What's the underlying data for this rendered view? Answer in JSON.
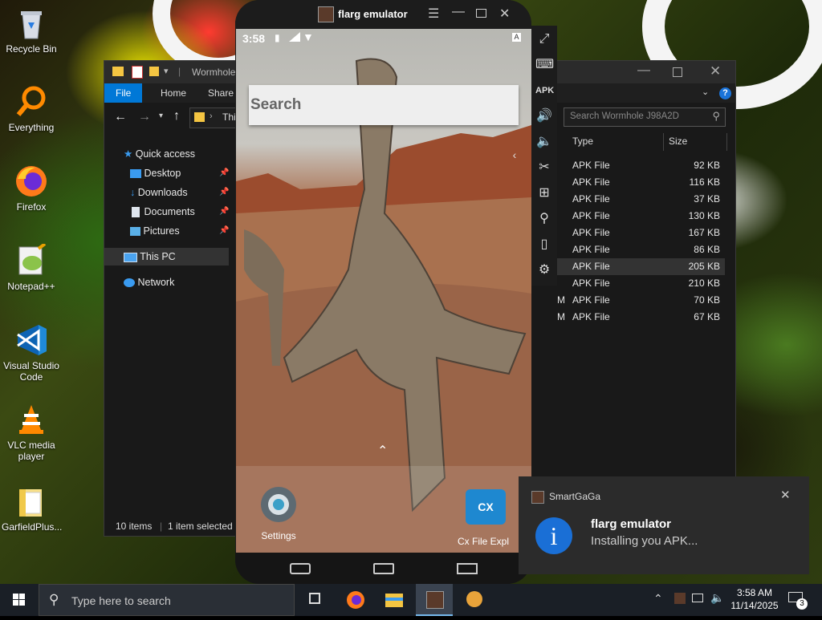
{
  "desktop": {
    "icons": [
      {
        "label": "Recycle Bin",
        "icon": "recycle-bin-icon"
      },
      {
        "label": "Everything",
        "icon": "everything-search-icon"
      },
      {
        "label": "Firefox",
        "icon": "firefox-icon"
      },
      {
        "label": "Notepad++",
        "icon": "notepad-plus-plus-icon"
      },
      {
        "label": "Visual Studio Code",
        "icon": "vscode-icon"
      },
      {
        "label": "VLC media player",
        "icon": "vlc-icon"
      },
      {
        "label": "GarfieldPlus...",
        "icon": "folder-icon"
      }
    ]
  },
  "explorer": {
    "title": "Wormhole",
    "ribbon_tabs": [
      "File",
      "Home",
      "Share"
    ],
    "address": "This",
    "search_placeholder": "Search Wormhole J98A2D",
    "nav": [
      {
        "label": "Quick access",
        "icon": "star-icon"
      },
      {
        "label": "Desktop",
        "icon": "desktop-folder-icon"
      },
      {
        "label": "Downloads",
        "icon": "downloads-icon"
      },
      {
        "label": "Documents",
        "icon": "documents-icon"
      },
      {
        "label": "Pictures",
        "icon": "pictures-icon"
      },
      {
        "label": "This PC",
        "icon": "pc-icon"
      },
      {
        "label": "Network",
        "icon": "network-icon"
      }
    ],
    "columns": {
      "type": "Type",
      "size": "Size"
    },
    "rows": [
      {
        "type": "APK File",
        "size": "92 KB",
        "clip": ""
      },
      {
        "type": "APK File",
        "size": "116 KB",
        "clip": ""
      },
      {
        "type": "APK File",
        "size": "37 KB",
        "clip": ""
      },
      {
        "type": "APK File",
        "size": "130 KB",
        "clip": ""
      },
      {
        "type": "APK File",
        "size": "167 KB",
        "clip": ""
      },
      {
        "type": "APK File",
        "size": "86 KB",
        "clip": ""
      },
      {
        "type": "APK File",
        "size": "205 KB",
        "clip": "",
        "selected": true
      },
      {
        "type": "APK File",
        "size": "210 KB",
        "clip": ""
      },
      {
        "type": "APK File",
        "size": "70 KB",
        "clip": "M"
      },
      {
        "type": "APK File",
        "size": "67 KB",
        "clip": "M"
      }
    ],
    "status": {
      "items": "10 items",
      "selected": "1 item selected"
    }
  },
  "emulator": {
    "title": "flarg emulator",
    "time": "3:58",
    "search_placeholder": "Search",
    "dock": [
      {
        "label": "Settings",
        "icon": "settings-gear-icon"
      },
      {
        "label": "Cx File Expl",
        "icon": "cx-file-explorer-icon"
      }
    ]
  },
  "notification": {
    "app": "SmartGaGa",
    "title": "flarg emulator",
    "body": "Installing you APK..."
  },
  "taskbar": {
    "search_placeholder": "Type here to search",
    "clock_time": "3:58 AM",
    "clock_date": "11/14/2025",
    "notif_count": "3"
  },
  "colors": {
    "accent": "#0078d7",
    "explorer_bg": "#191919",
    "taskbar_bg": "#1a1f26",
    "info_blue": "#1a6fd6"
  }
}
